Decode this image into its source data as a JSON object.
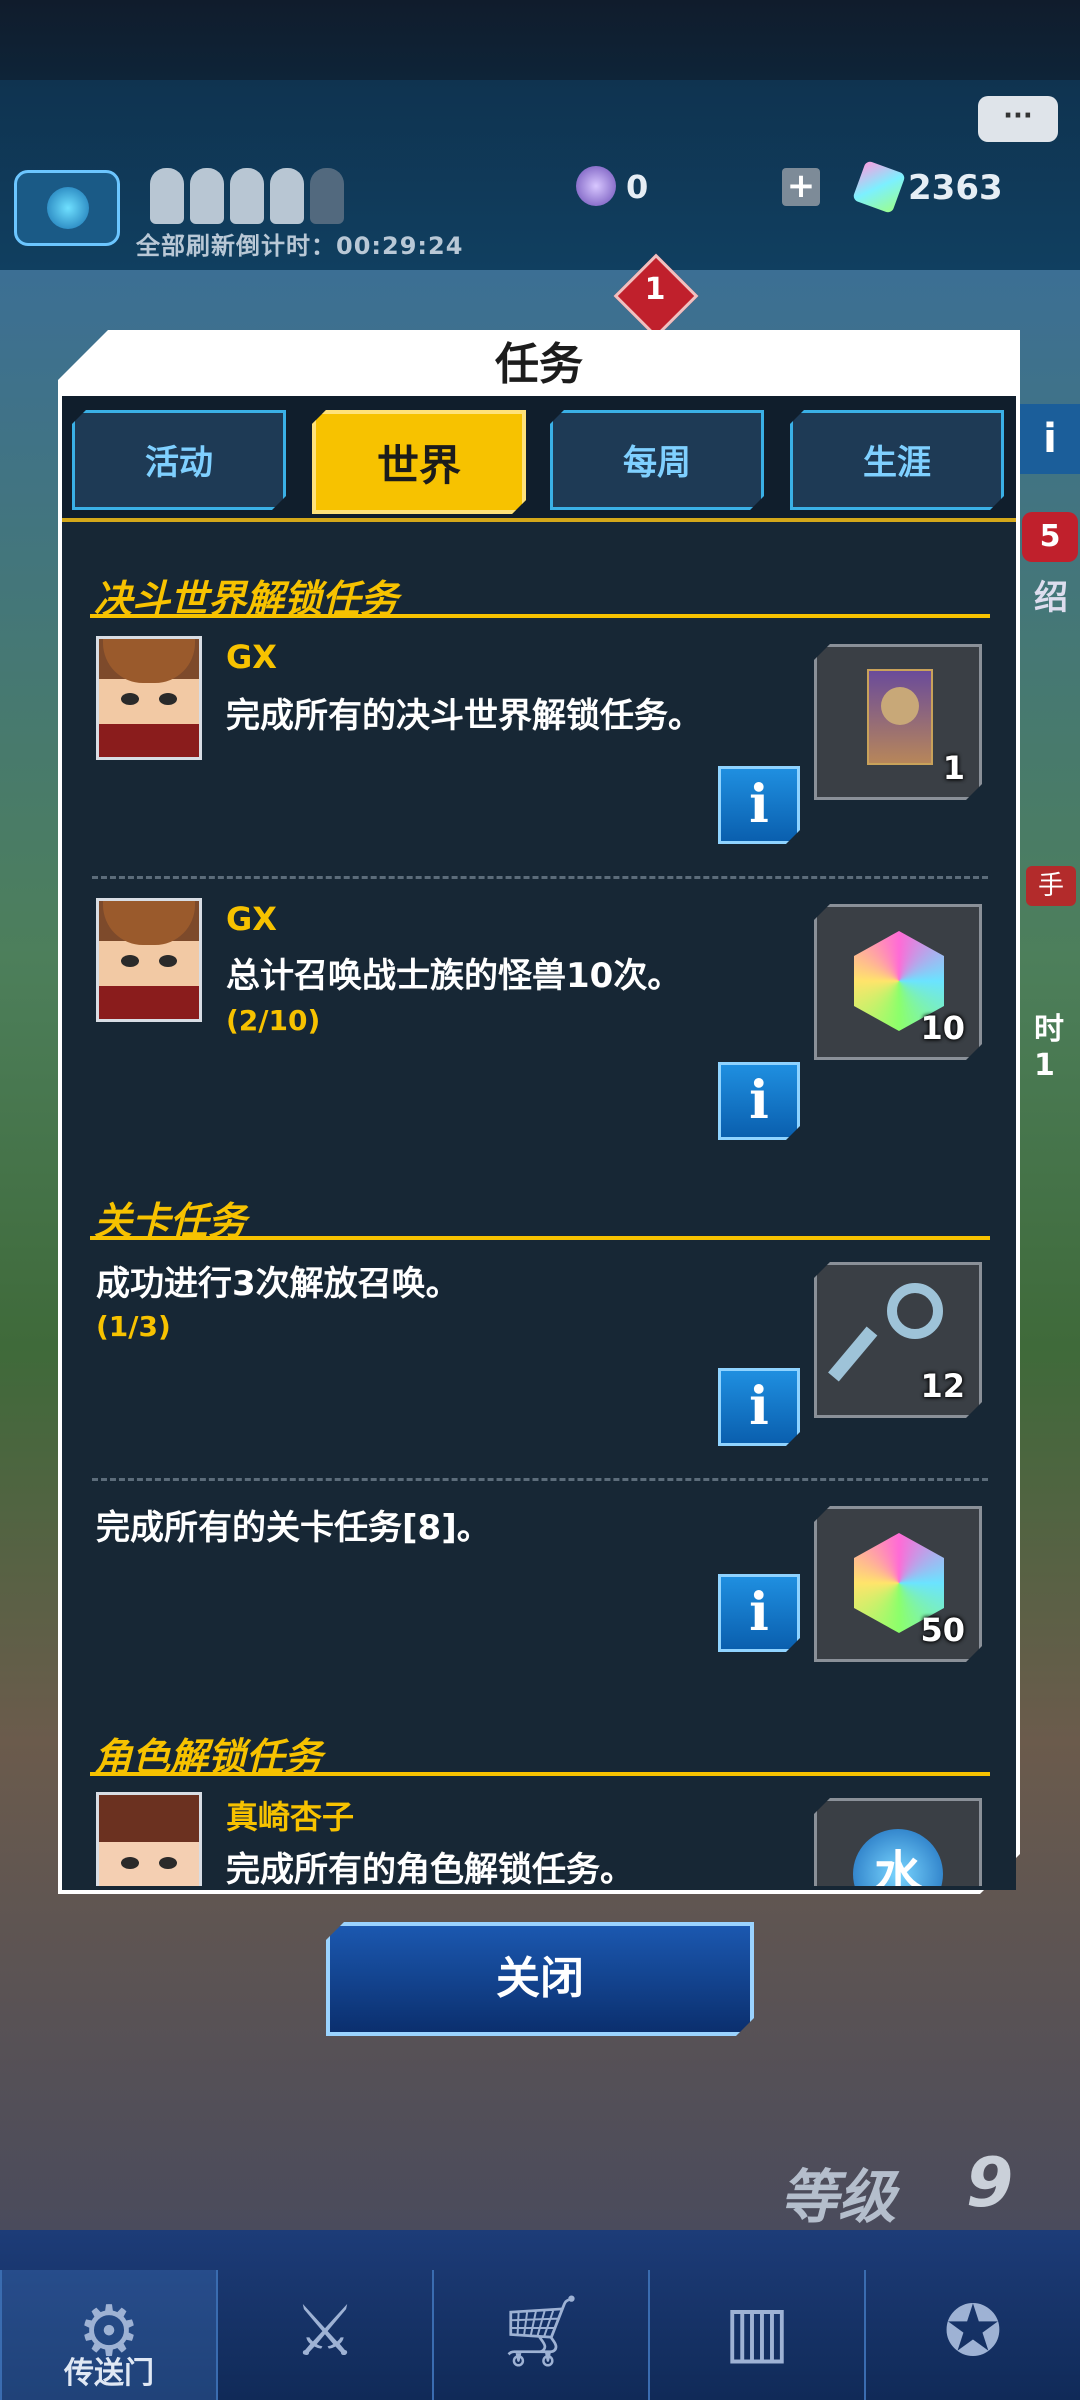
{
  "hud": {
    "refresh_countdown": "全部刷新倒计时：00:29:24",
    "orb_count": "0",
    "plus": "+",
    "gem_count": "2363",
    "notification_badge": "1",
    "chat_icon": "speech-bubble-icon"
  },
  "side": {
    "info": "i",
    "badge": "5",
    "partial_text_1": "绍",
    "partial_text_2": "手",
    "partial_text_3": "时1"
  },
  "modal": {
    "title": "任务",
    "tabs": [
      {
        "label": "活动",
        "active": false
      },
      {
        "label": "世界",
        "active": true
      },
      {
        "label": "每周",
        "active": false
      },
      {
        "label": "生涯",
        "active": false
      }
    ],
    "sections": [
      {
        "header": "决斗世界解锁任务",
        "tasks": [
          {
            "character": "GX",
            "description": "完成所有的决斗世界解锁任务。",
            "progress": "",
            "reward_icon": "card-icon",
            "reward_qty": "1"
          },
          {
            "character": "GX",
            "description": "总计召唤战士族的怪兽10次。",
            "progress": "(2/10)",
            "reward_icon": "gem-icon",
            "reward_qty": "10"
          }
        ]
      },
      {
        "header": "关卡任务",
        "tasks": [
          {
            "character": "",
            "description": "成功进行3次解放召唤。",
            "progress": "(1/3)",
            "reward_icon": "key-icon",
            "reward_qty": "12"
          },
          {
            "character": "",
            "description": "完成所有的关卡任务[8]。",
            "progress": "",
            "reward_icon": "gem-icon",
            "reward_qty": "50"
          }
        ]
      },
      {
        "header": "角色解锁任务",
        "tasks": [
          {
            "character": "真崎杏子",
            "description": "完成所有的角色解锁任务。",
            "progress": "",
            "reward_icon": "water-attribute-icon",
            "reward_qty": ""
          }
        ]
      }
    ],
    "info_label": "i",
    "water_glyph": "水",
    "close_label": "关闭"
  },
  "background": {
    "level_label": "等级",
    "level_value": "9",
    "nav": [
      {
        "label": "传送门",
        "icon": "portal-icon"
      },
      {
        "label": "",
        "icon": "crossed-swords-icon"
      },
      {
        "label": "",
        "icon": "shop-cart-icon"
      },
      {
        "label": "",
        "icon": "cards-icon"
      },
      {
        "label": "",
        "icon": "duelist-icon"
      }
    ]
  },
  "colors": {
    "accent_gold": "#f7c200",
    "panel_dark": "#172735",
    "tab_blue": "#3ab0e6",
    "button_blue": "#1b58b0"
  }
}
